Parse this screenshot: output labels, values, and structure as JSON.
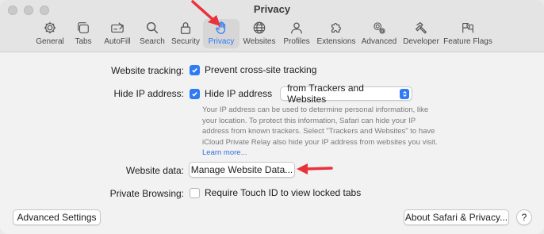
{
  "window": {
    "title": "Privacy"
  },
  "tabs": [
    {
      "id": "general",
      "label": "General",
      "icon": "gear-icon"
    },
    {
      "id": "tabs",
      "label": "Tabs",
      "icon": "tabs-icon"
    },
    {
      "id": "autofill",
      "label": "AutoFill",
      "icon": "autofill-icon"
    },
    {
      "id": "search",
      "label": "Search",
      "icon": "search-icon"
    },
    {
      "id": "security",
      "label": "Security",
      "icon": "lock-icon"
    },
    {
      "id": "privacy",
      "label": "Privacy",
      "icon": "hand-icon",
      "active": true
    },
    {
      "id": "websites",
      "label": "Websites",
      "icon": "globe-icon"
    },
    {
      "id": "profiles",
      "label": "Profiles",
      "icon": "person-icon"
    },
    {
      "id": "extensions",
      "label": "Extensions",
      "icon": "puzzle-icon"
    },
    {
      "id": "advanced",
      "label": "Advanced",
      "icon": "gears-icon"
    },
    {
      "id": "developer",
      "label": "Developer",
      "icon": "hammer-icon"
    },
    {
      "id": "feature_flags",
      "label": "Feature Flags",
      "icon": "flags-icon"
    }
  ],
  "settings": {
    "website_tracking": {
      "label": "Website tracking:",
      "option": "Prevent cross-site tracking",
      "checked": true
    },
    "hide_ip": {
      "label": "Hide IP address:",
      "option": "Hide IP address",
      "checked": true,
      "select_value": "from Trackers and Websites",
      "description": "Your IP address can be used to determine personal information, like your location. To protect this information, Safari can hide your IP address from known trackers. Select \"Trackers and Websites\" to have iCloud Private Relay also hide your IP address from websites you visit.",
      "link": "Learn more..."
    },
    "website_data": {
      "label": "Website data:",
      "button": "Manage Website Data..."
    },
    "private_browsing": {
      "label": "Private Browsing:",
      "option": "Require Touch ID to view locked tabs",
      "checked": false
    }
  },
  "footer": {
    "advanced_button": "Advanced Settings",
    "about_button": "About Safari & Privacy...",
    "help_button": "?"
  },
  "colors": {
    "accent": "#2f7bf5",
    "annotation": "#e8323c"
  }
}
